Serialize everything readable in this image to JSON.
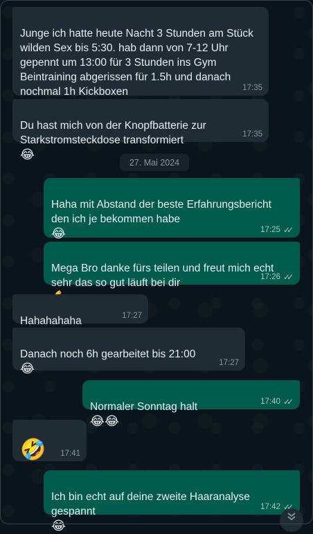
{
  "date_divider": "27. Mai 2024",
  "messages": [
    {
      "dir": "in",
      "text": "Junge ich hatte heute Nacht 3 Stunden am Stück wilden Sex bis 5:30. hab dann von 7-12 Uhr gepennt um 13:00 für 3 Stunden ins Gym Beintraining abgerissen für 1.5h und danach nochmal 1h Kickboxen",
      "emoji": "😂",
      "time": "17:35"
    },
    {
      "dir": "in",
      "text": "Du hast mich von der Knopfbatterie zur Starkstromsteckdose transformiert",
      "emoji": "😂",
      "time": "17:35"
    },
    {
      "dir": "out",
      "text": "Haha mit Abstand der beste Erfahrungsbericht den ich je bekommen habe",
      "emoji": "😂",
      "time": "17:25",
      "ticks": "✓✓"
    },
    {
      "dir": "out",
      "text": "Mega Bro danke fürs teilen und freut mich echt sehr das so gut läuft bei dir",
      "emoji": "💪",
      "time": "17:26",
      "ticks": "✓✓"
    },
    {
      "dir": "in",
      "text": "Hahahahaha",
      "emoji": "😂",
      "time": "17:27"
    },
    {
      "dir": "in",
      "text": "Danach noch 6h gearbeitet bis 21:00",
      "emoji": "😂",
      "time": "17:27"
    },
    {
      "dir": "out",
      "text": "Normaler Sonntag halt",
      "emoji": "😂😂",
      "time": "17:40",
      "ticks": "✓✓"
    },
    {
      "dir": "in",
      "text": "",
      "emoji": "🤣",
      "time": "17:41"
    },
    {
      "dir": "out",
      "text": "Ich bin echt auf deine zweite Haaranalyse gespannt",
      "emoji": "😂",
      "time": "17:42",
      "ticks": "✓✓"
    }
  ],
  "scroll_down_icon": "chevron-double-down-icon",
  "colors": {
    "background": "#0b141a",
    "incoming": "#202c33",
    "outgoing": "#005c4b",
    "meta": "#8696a0"
  }
}
